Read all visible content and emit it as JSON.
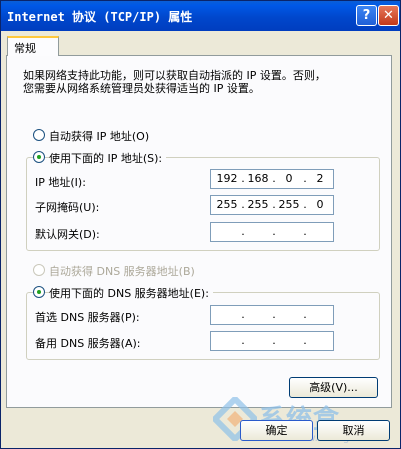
{
  "window": {
    "title": "Internet 协议 (TCP/IP) 属性",
    "help_label": "?",
    "close_label": "✕"
  },
  "tabs": [
    {
      "label": "常规",
      "active": true
    }
  ],
  "intro": {
    "line1": "如果网络支持此功能，则可以获取自动指派的 IP 设置。否则，",
    "line2": "您需要从网络系统管理员处获得适当的 IP 设置。"
  },
  "ip_mode": {
    "auto_label": "自动获得 IP 地址(O)",
    "manual_label": "使用下面的 IP 地址(S):",
    "selected": "manual"
  },
  "ip_fields": [
    {
      "label": "IP 地址(I):",
      "octets": [
        "192",
        "168",
        "0",
        "2"
      ]
    },
    {
      "label": "子网掩码(U):",
      "octets": [
        "255",
        "255",
        "255",
        "0"
      ]
    },
    {
      "label": "默认网关(D):",
      "octets": [
        "",
        "",
        "",
        ""
      ]
    }
  ],
  "dns_mode": {
    "auto_label": "自动获得 DNS 服务器地址(B)",
    "manual_label": "使用下面的 DNS 服务器地址(E):",
    "selected": "manual",
    "auto_disabled": true
  },
  "dns_fields": [
    {
      "label": "首选 DNS 服务器(P):",
      "octets": [
        "",
        "",
        "",
        ""
      ]
    },
    {
      "label": "备用 DNS 服务器(A):",
      "octets": [
        "",
        "",
        "",
        ""
      ]
    }
  ],
  "buttons": {
    "advanced": "高级(V)...",
    "ok": "确定",
    "cancel": "取消"
  },
  "watermark": {
    "text": "系统盒",
    "url": "www.xitonghe.com"
  },
  "colors": {
    "titlebar": "#0054e3",
    "radio_dot": "#21a121",
    "tab_highlight": "#ffc83c"
  }
}
